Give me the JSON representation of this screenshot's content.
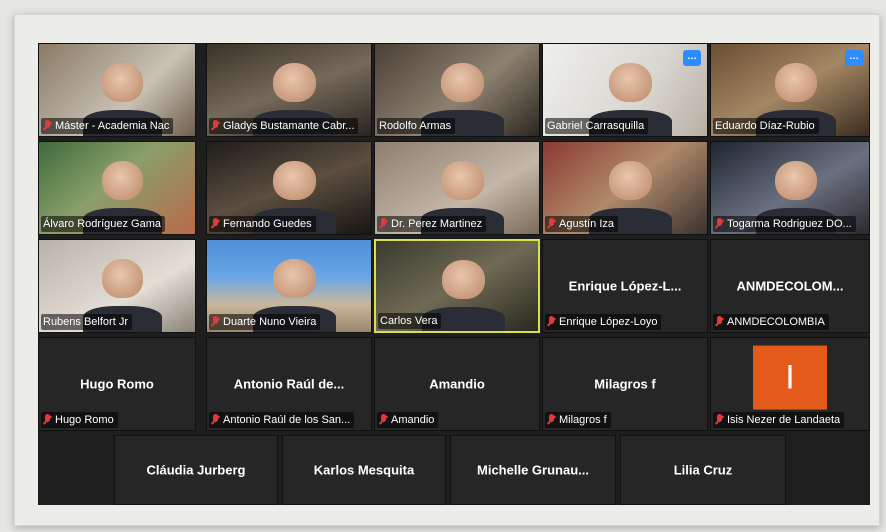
{
  "colors": {
    "active_border": "#d8e04a",
    "mic_muted": "#e03a3a",
    "avatar_bg": "#e35a1a",
    "badge_blue": "#2d8cff"
  },
  "participants": [
    {
      "label": "Máster - Academia Nac",
      "bigname": "",
      "kind": "video",
      "cls": "v1",
      "muted": true
    },
    {
      "label": "Gladys Bustamante Cabr...",
      "bigname": "",
      "kind": "video",
      "cls": "v2",
      "muted": true
    },
    {
      "label": "Rodolfo Armas",
      "bigname": "",
      "kind": "video",
      "cls": "v3",
      "muted": false
    },
    {
      "label": "Gabriel Carrasquilla",
      "bigname": "",
      "kind": "video",
      "cls": "v4",
      "muted": false,
      "badge": "…"
    },
    {
      "label": "Eduardo Díaz-Rubio",
      "bigname": "",
      "kind": "video",
      "cls": "v5",
      "muted": false,
      "badge": "…"
    },
    {
      "label": "Álvaro Rodríguez Gama",
      "bigname": "",
      "kind": "video",
      "cls": "v6",
      "muted": false
    },
    {
      "label": "Fernando Guedes",
      "bigname": "",
      "kind": "video",
      "cls": "v7",
      "muted": true
    },
    {
      "label": "Dr. Perez Martinez",
      "bigname": "",
      "kind": "video",
      "cls": "v8",
      "muted": true
    },
    {
      "label": "Agustín Iza",
      "bigname": "",
      "kind": "video",
      "cls": "v9",
      "muted": true
    },
    {
      "label": "Togarma Rodriguez DO...",
      "bigname": "",
      "kind": "video",
      "cls": "v10",
      "muted": true
    },
    {
      "label": "Rubens Belfort Jr",
      "bigname": "",
      "kind": "video",
      "cls": "v11",
      "muted": false
    },
    {
      "label": "Duarte Nuno Vieira",
      "bigname": "",
      "kind": "video",
      "cls": "v12",
      "muted": true
    },
    {
      "label": "Carlos Vera",
      "bigname": "",
      "kind": "video",
      "cls": "v13",
      "muted": false,
      "active": true
    },
    {
      "label": "Enrique López-Loyo",
      "bigname": "Enrique  López-L...",
      "kind": "name",
      "muted": true
    },
    {
      "label": "ANMDECOLOMBIA",
      "bigname": "ANMDECOLOM...",
      "kind": "name",
      "muted": true
    },
    {
      "label": "Hugo Romo",
      "bigname": "Hugo Romo",
      "kind": "name",
      "muted": true
    },
    {
      "label": "Antonio Raúl de los San...",
      "bigname": "Antonio  Raúl  de...",
      "kind": "name",
      "muted": true
    },
    {
      "label": "Amandio",
      "bigname": "Amandio",
      "kind": "name",
      "muted": true
    },
    {
      "label": "Milagros f",
      "bigname": "Milagros  f",
      "kind": "name",
      "muted": true
    },
    {
      "label": "Isis Nezer de Landaeta",
      "bigname": "",
      "kind": "avatar",
      "avatar_letter": "I",
      "muted": true
    },
    {
      "label": "",
      "bigname": "Cláudia Jurberg",
      "kind": "name",
      "muted": false
    },
    {
      "label": "",
      "bigname": "Karlos Mesquita",
      "kind": "name",
      "muted": false
    },
    {
      "label": "",
      "bigname": "Michelle  Grunau...",
      "kind": "name",
      "muted": false
    },
    {
      "label": "",
      "bigname": "Lilia Cruz",
      "kind": "name",
      "muted": false
    }
  ]
}
